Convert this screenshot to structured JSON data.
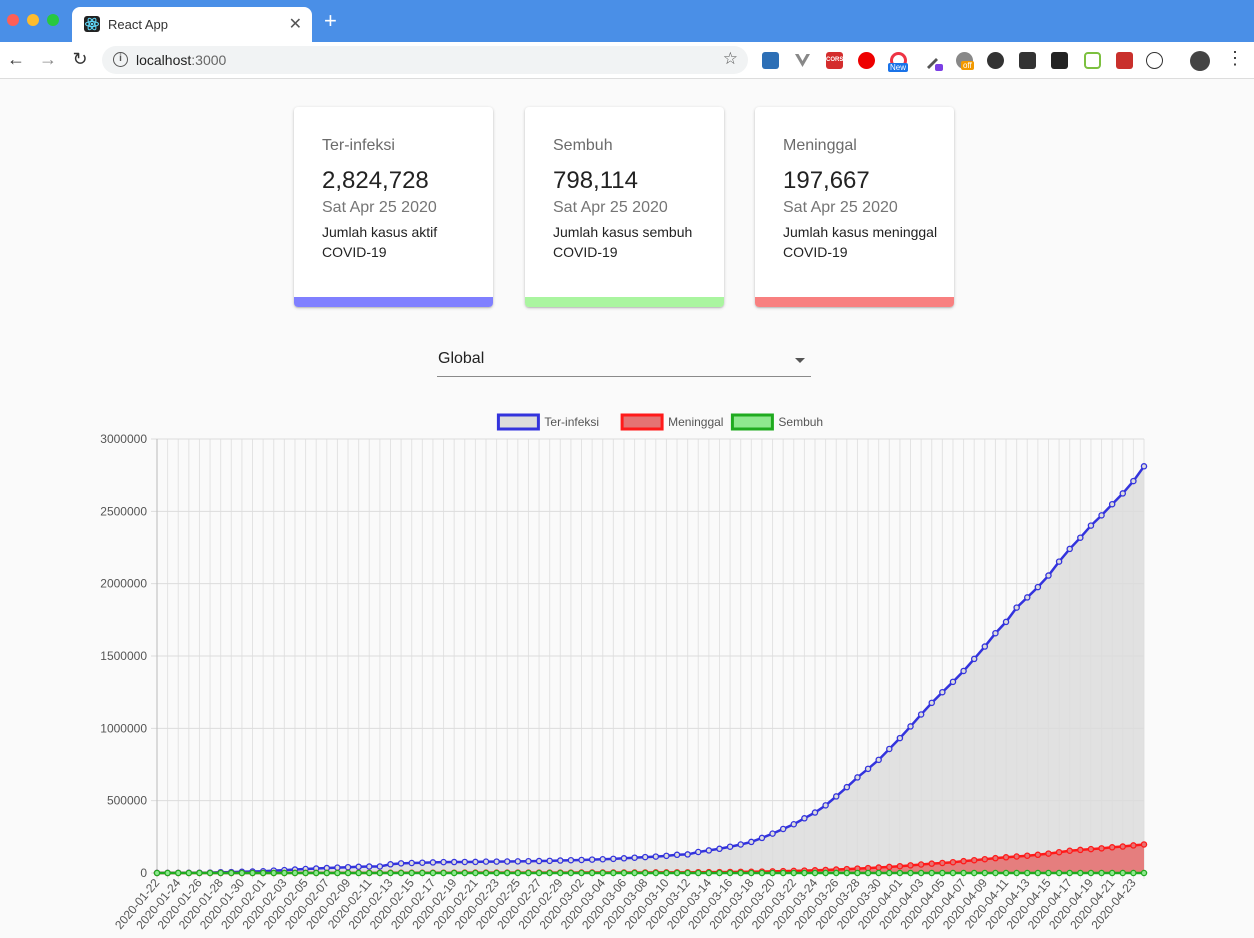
{
  "browser": {
    "tab_title": "React App",
    "url_host": "localhost",
    "url_port": ":3000",
    "new_badge": "New",
    "off_badge": "off",
    "cors_label": "CORS"
  },
  "cards": [
    {
      "title": "Ter-infeksi",
      "value": "2,824,728",
      "date": "Sat Apr 25 2020",
      "desc": "Jumlah kasus aktif COVID-19",
      "color": "#8080ff"
    },
    {
      "title": "Sembuh",
      "value": "798,114",
      "date": "Sat Apr 25 2020",
      "desc": "Jumlah kasus sembuh COVID-19",
      "color": "#aaf5a0"
    },
    {
      "title": "Meninggal",
      "value": "197,667",
      "date": "Sat Apr 25 2020",
      "desc": "Jumlah kasus meninggal COVID-19",
      "color": "#f88080"
    }
  ],
  "country_select": {
    "value": "Global"
  },
  "chart_data": {
    "type": "line",
    "legend_position": "top",
    "grid": true,
    "ylim": [
      0,
      3000000
    ],
    "yticks": [
      0,
      500000,
      1000000,
      1500000,
      2000000,
      2500000,
      3000000
    ],
    "x": [
      "2020-01-22",
      "2020-01-23",
      "2020-01-24",
      "2020-01-25",
      "2020-01-26",
      "2020-01-27",
      "2020-01-28",
      "2020-01-29",
      "2020-01-30",
      "2020-01-31",
      "2020-02-01",
      "2020-02-02",
      "2020-02-03",
      "2020-02-04",
      "2020-02-05",
      "2020-02-06",
      "2020-02-07",
      "2020-02-08",
      "2020-02-09",
      "2020-02-10",
      "2020-02-11",
      "2020-02-12",
      "2020-02-13",
      "2020-02-14",
      "2020-02-15",
      "2020-02-16",
      "2020-02-17",
      "2020-02-18",
      "2020-02-19",
      "2020-02-20",
      "2020-02-21",
      "2020-02-22",
      "2020-02-23",
      "2020-02-24",
      "2020-02-25",
      "2020-02-26",
      "2020-02-27",
      "2020-02-28",
      "2020-02-29",
      "2020-03-01",
      "2020-03-02",
      "2020-03-03",
      "2020-03-04",
      "2020-03-05",
      "2020-03-06",
      "2020-03-07",
      "2020-03-08",
      "2020-03-09",
      "2020-03-10",
      "2020-03-11",
      "2020-03-12",
      "2020-03-13",
      "2020-03-14",
      "2020-03-15",
      "2020-03-16",
      "2020-03-17",
      "2020-03-18",
      "2020-03-19",
      "2020-03-20",
      "2020-03-21",
      "2020-03-22",
      "2020-03-23",
      "2020-03-24",
      "2020-03-25",
      "2020-03-26",
      "2020-03-27",
      "2020-03-28",
      "2020-03-29",
      "2020-03-30",
      "2020-03-31",
      "2020-04-01",
      "2020-04-02",
      "2020-04-03",
      "2020-04-04",
      "2020-04-05",
      "2020-04-06",
      "2020-04-07",
      "2020-04-08",
      "2020-04-09",
      "2020-04-10",
      "2020-04-11",
      "2020-04-12",
      "2020-04-13",
      "2020-04-14",
      "2020-04-15",
      "2020-04-16",
      "2020-04-17",
      "2020-04-18",
      "2020-04-19",
      "2020-04-20",
      "2020-04-21",
      "2020-04-22",
      "2020-04-23",
      "2020-04-24"
    ],
    "series": [
      {
        "name": "Ter-infeksi",
        "border_color": "#3333dd",
        "fill_color": "#dcdcdc",
        "values": [
          555,
          654,
          941,
          1434,
          2118,
          2927,
          5578,
          6166,
          8234,
          9927,
          12038,
          16787,
          19881,
          23892,
          27635,
          30794,
          34391,
          37120,
          40150,
          42762,
          44802,
          45221,
          60368,
          66885,
          69030,
          71224,
          73258,
          75136,
          75639,
          76197,
          76819,
          78572,
          78958,
          79561,
          80406,
          81388,
          82746,
          84112,
          86011,
          88369,
          90306,
          92840,
          95120,
          97886,
          101800,
          105847,
          109821,
          113590,
          118620,
          125875,
          128352,
          145205,
          156101,
          167454,
          181574,
          197102,
          214821,
          242570,
          272208,
          304507,
          336953,
          378235,
          418045,
          467653,
          529591,
          593291,
          660706,
          720117,
          782365,
          857487,
          932605,
          1013157,
          1095917,
          1176060,
          1249754,
          1321481,
          1396476,
          1479804,
          1565278,
          1657526,
          1735650,
          1834721,
          1904838,
          1976191,
          2056054,
          2152437,
          2240191,
          2317759,
          2401379,
          2472259,
          2549123,
          2624035,
          2708885,
          2811193
        ]
      },
      {
        "name": "Meninggal",
        "border_color": "#ff1a1a",
        "fill_color": "#e57373",
        "values": [
          17,
          18,
          26,
          42,
          56,
          82,
          131,
          133,
          171,
          213,
          259,
          362,
          426,
          492,
          564,
          634,
          719,
          806,
          906,
          1013,
          1113,
          1118,
          1371,
          1523,
          1666,
          1770,
          1868,
          2007,
          2122,
          2247,
          2251,
          2458,
          2469,
          2629,
          2708,
          2770,
          2814,
          2872,
          2941,
          2996,
          3085,
          3160,
          3254,
          3348,
          3460,
          3558,
          3802,
          3988,
          4262,
          4615,
          4720,
          5404,
          5819,
          6440,
          7126,
          7905,
          8733,
          9867,
          11299,
          12973,
          14623,
          16497,
          18615,
          21181,
          23970,
          27198,
          30652,
          33925,
          37582,
          42107,
          46809,
          52983,
          58787,
          64606,
          69374,
          74565,
          81865,
          88338,
          95455,
          102525,
          108503,
          114091,
          119482,
          125984,
          134177,
          143800,
          153822,
          159510,
          165044,
          170423,
          177644,
          183066,
          190858,
          197159
        ]
      },
      {
        "name": "Sembuh",
        "border_color": "#1faa1f",
        "fill_color": "#8ee88e",
        "values": [
          0,
          0,
          0,
          0,
          0,
          0,
          0,
          0,
          0,
          0,
          0,
          0,
          0,
          0,
          0,
          0,
          0,
          0,
          0,
          0,
          0,
          0,
          0,
          0,
          0,
          0,
          0,
          0,
          0,
          0,
          0,
          0,
          0,
          0,
          0,
          0,
          0,
          0,
          0,
          0,
          0,
          0,
          0,
          0,
          0,
          0,
          0,
          0,
          0,
          0,
          0,
          0,
          0,
          0,
          0,
          0,
          0,
          0,
          0,
          0,
          0,
          0,
          0,
          0,
          0,
          0,
          0,
          0,
          0,
          0,
          0,
          0,
          0,
          0,
          0,
          0,
          0,
          0,
          0,
          0,
          0,
          0,
          0,
          0,
          0,
          0,
          0,
          0,
          0,
          0,
          0,
          0,
          0,
          0
        ]
      }
    ]
  }
}
